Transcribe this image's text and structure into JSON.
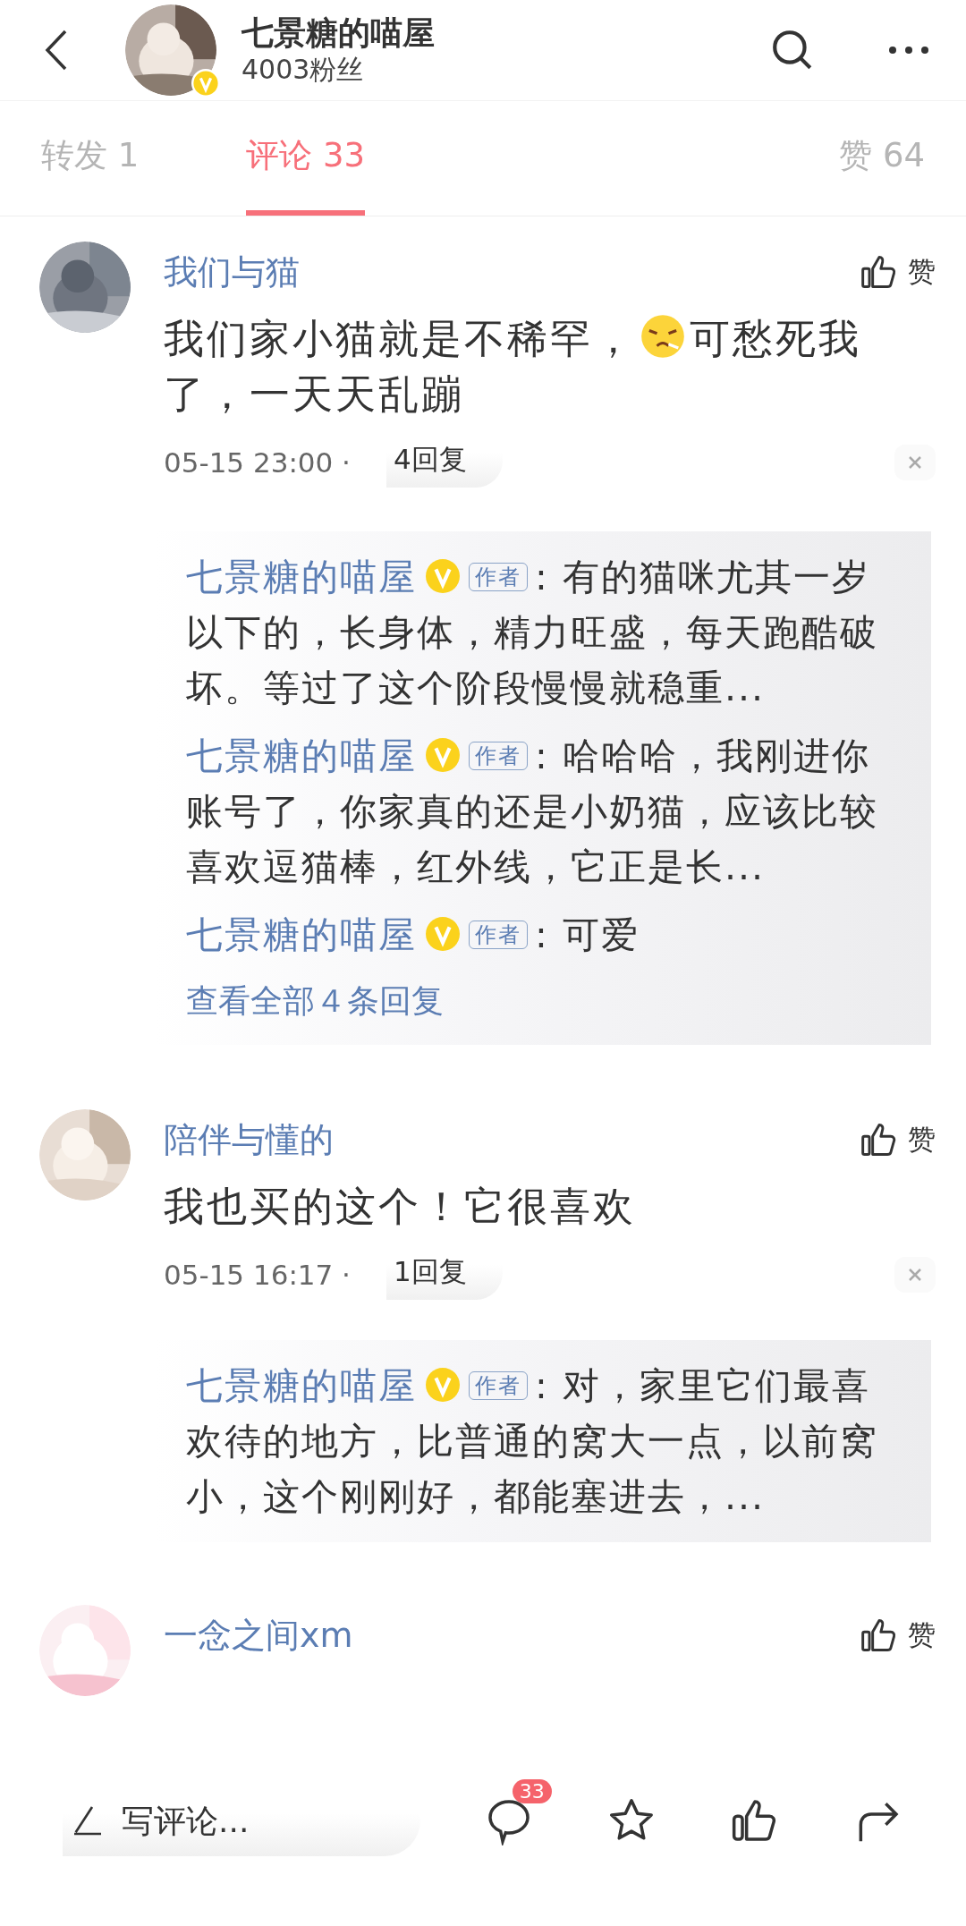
{
  "header": {
    "title": "七景糖的喵屋",
    "subtitle": "4003粉丝",
    "verified": true
  },
  "tabs": [
    {
      "label": "转发 1",
      "selected": false
    },
    {
      "label": "评论 33",
      "selected": true
    },
    {
      "label": "赞 64",
      "selected": false
    }
  ],
  "comments": [
    {
      "user": "我们与猫",
      "like": "赞",
      "text": [
        {
          "kind": "text",
          "text": "我们家小猫就是不稀罕，"
        },
        {
          "kind": "emoji"
        },
        {
          "kind": "text",
          "text": "可愁死我了，一天天乱蹦"
        }
      ],
      "time": "05-15 23:00 ·",
      "reply_count": "4回复",
      "replies": [
        {
          "user": "七景糖的喵屋",
          "verified": true,
          "badge": "作者",
          "text": ": 有的猫咪尤其一岁以下的，长身体，精力旺盛，每天跑酷破坏。等过了这个阶段慢慢就稳重..."
        },
        {
          "user": "七景糖的喵屋",
          "verified": true,
          "badge": "作者",
          "text": ": 哈哈哈，我刚进你账号了，你家真的还是小奶猫，应该比较喜欢逗猫棒，红外线，它正是长..."
        },
        {
          "user": "七景糖的喵屋",
          "verified": true,
          "badge": "作者",
          "text": ": 可爱"
        }
      ],
      "more": "查看全部４条回复"
    },
    {
      "user": "陪伴与懂的",
      "like": "赞",
      "text": [
        {
          "kind": "text",
          "text": "我也买的这个！它很喜欢"
        }
      ],
      "time": "05-15 16:17 ·",
      "reply_count": "1回复",
      "replies": [
        {
          "user": "七景糖的喵屋",
          "verified": true,
          "badge": "作者",
          "text": ": 对，家里它们最喜欢待的地方，比普通的窝大一点，以前窝小，这个刚刚好，都能塞进去，..."
        }
      ]
    },
    {
      "user": "一念之间xm",
      "like": "赞"
    }
  ],
  "bottom_bar": {
    "placeholder": "写评论...",
    "comment_count": "33"
  }
}
